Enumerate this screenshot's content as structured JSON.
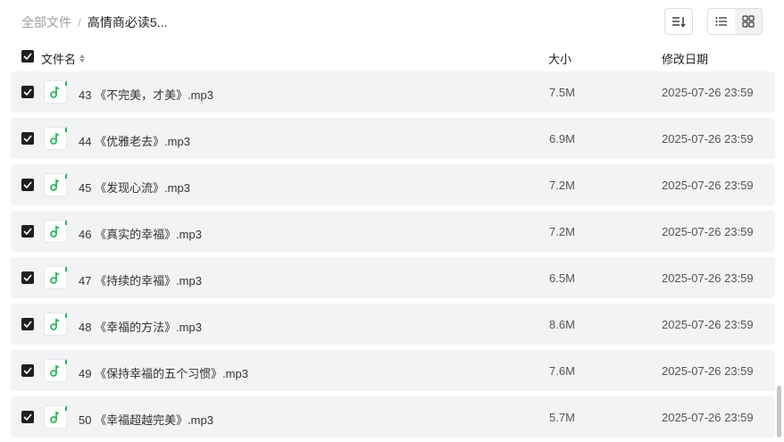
{
  "breadcrumb": {
    "root": "全部文件",
    "separator": "/",
    "current": "高情商必读5..."
  },
  "toolbar": {
    "sort_icon": "sort-list-icon",
    "list_view_icon": "list-view-icon",
    "grid_view_icon": "grid-view-icon",
    "active_view": "list"
  },
  "table": {
    "headers": {
      "name": "文件名",
      "size": "大小",
      "date": "修改日期"
    },
    "all_selected": true,
    "rows": [
      {
        "name": "43 《不完美，才美》.mp3",
        "size": "7.5M",
        "date": "2025-07-26 23:59",
        "selected": true
      },
      {
        "name": "44 《优雅老去》.mp3",
        "size": "6.9M",
        "date": "2025-07-26 23:59",
        "selected": true
      },
      {
        "name": "45 《发现心流》.mp3",
        "size": "7.2M",
        "date": "2025-07-26 23:59",
        "selected": true
      },
      {
        "name": "46 《真实的幸福》.mp3",
        "size": "7.2M",
        "date": "2025-07-26 23:59",
        "selected": true
      },
      {
        "name": "47 《持续的幸福》.mp3",
        "size": "6.5M",
        "date": "2025-07-26 23:59",
        "selected": true
      },
      {
        "name": "48 《幸福的方法》.mp3",
        "size": "8.6M",
        "date": "2025-07-26 23:59",
        "selected": true
      },
      {
        "name": "49 《保持幸福的五个习惯》.mp3",
        "size": "7.6M",
        "date": "2025-07-26 23:59",
        "selected": true
      },
      {
        "name": "50 《幸福超越完美》.mp3",
        "size": "5.7M",
        "date": "2025-07-26 23:59",
        "selected": true
      }
    ]
  },
  "colors": {
    "row_bg": "#f2f3f5",
    "audio_icon": "#2db55d",
    "checkbox": "#1f1f1f"
  }
}
